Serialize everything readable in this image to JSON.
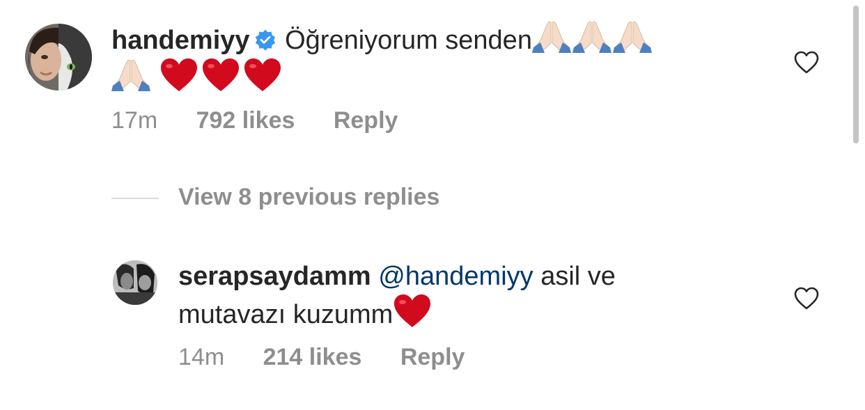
{
  "comment": {
    "username": "handemiyy",
    "verified": true,
    "text": "Öğreniyorum senden",
    "time": "17m",
    "likes": "792 likes",
    "reply_label": "Reply"
  },
  "view_replies": {
    "label": "View 8 previous replies"
  },
  "reply": {
    "username": "serapsaydamm",
    "mention": "@handemiyy",
    "text_part1": " asil ve",
    "text_part2": "mutavazı kuzumm",
    "time": "14m",
    "likes": "214 likes",
    "reply_label": "Reply"
  },
  "colors": {
    "text": "#262626",
    "meta": "#8e8e8e",
    "mention": "#00376b",
    "verified": "#3897f0",
    "heart_emoji": "#d10a1e"
  }
}
